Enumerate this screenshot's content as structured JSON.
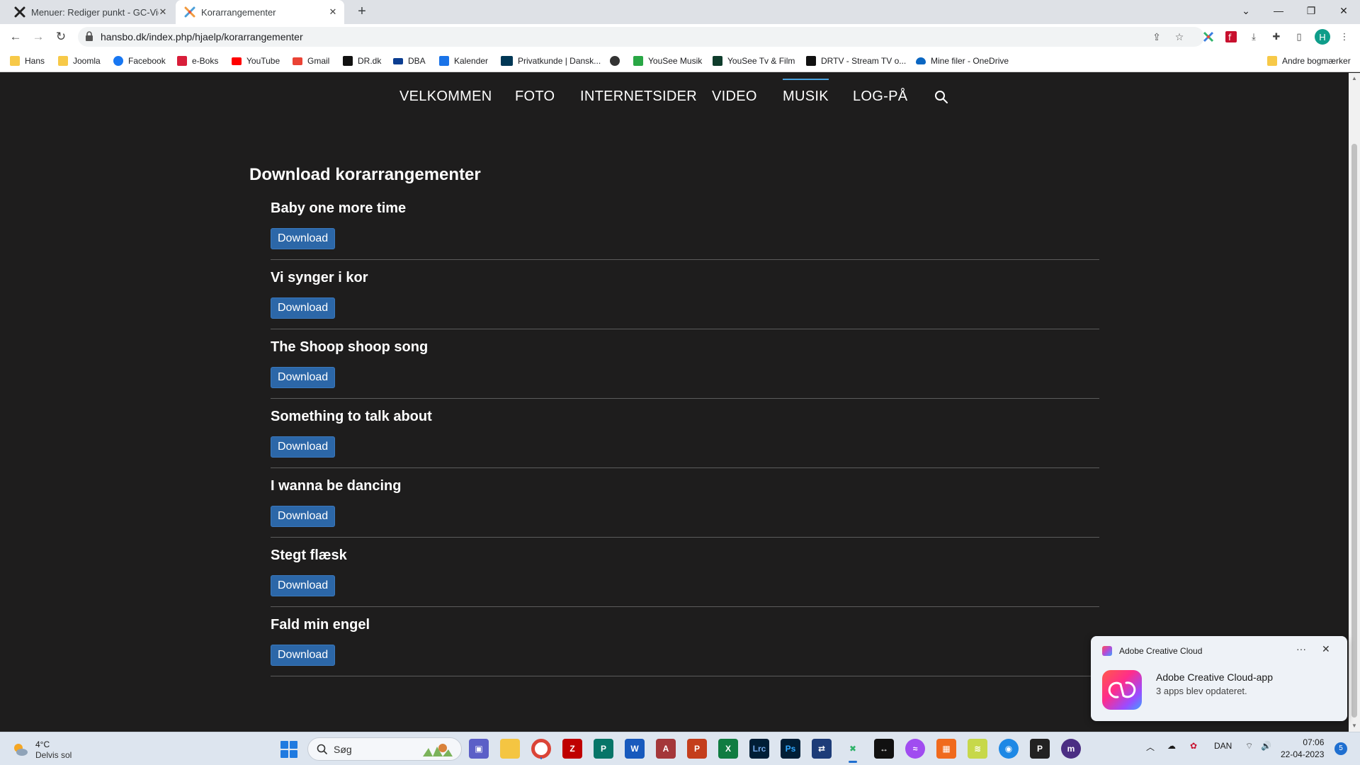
{
  "browser": {
    "tabs": [
      {
        "label": "Menuer: Rediger punkt - GC-Vid…",
        "close": "✕"
      },
      {
        "label": "Korarrangementer",
        "close": "✕"
      }
    ],
    "new_tab": "+",
    "url": "hansbo.dk/index.php/hjaelp/korarrangementer",
    "profile_initial": "H",
    "bookmarks": [
      {
        "label": "Hans",
        "icon": "folder-icon",
        "color": "#f7c948"
      },
      {
        "label": "Joomla",
        "icon": "folder-icon",
        "color": "#f7c948"
      },
      {
        "label": "Facebook",
        "icon": "facebook-icon",
        "color": "#1877f2"
      },
      {
        "label": "e-Boks",
        "icon": "eboks-icon",
        "color": "#d81e3a"
      },
      {
        "label": "YouTube",
        "icon": "youtube-icon",
        "color": "#ff0000"
      },
      {
        "label": "Gmail",
        "icon": "gmail-icon",
        "color": "#ea4335"
      },
      {
        "label": "DR.dk",
        "icon": "dr-icon",
        "color": "#111111"
      },
      {
        "label": "DBA",
        "icon": "dba-icon",
        "color": "#0b3d91"
      },
      {
        "label": "Kalender",
        "icon": "calendar-icon",
        "color": "#1a73e8"
      },
      {
        "label": "Privatkunde | Dansk...",
        "icon": "bank-icon",
        "color": "#003755"
      },
      {
        "label": "",
        "icon": "globe-icon",
        "color": "#333333"
      },
      {
        "label": "YouSee Musik",
        "icon": "music-icon",
        "color": "#29a745"
      },
      {
        "label": "YouSee Tv & Film",
        "icon": "yousee-tv-icon",
        "color": "#0f3d2c"
      },
      {
        "label": "DRTV - Stream TV o...",
        "icon": "drtv-icon",
        "color": "#111111"
      },
      {
        "label": "Mine filer - OneDrive",
        "icon": "onedrive-icon",
        "color": "#0a66c2"
      }
    ],
    "other_bookmarks": "Andre bogmærker"
  },
  "site": {
    "nav": [
      {
        "label": "VELKOMMEN",
        "active": false
      },
      {
        "label": "FOTO",
        "active": false
      },
      {
        "label": "INTERNETSIDER",
        "active": false
      },
      {
        "label": "VIDEO",
        "active": false
      },
      {
        "label": "MUSIK",
        "active": true
      },
      {
        "label": "LOG-PÅ",
        "active": false
      }
    ],
    "page_title": "Download korarrangementer",
    "download_label": "Download",
    "items": [
      {
        "title": "Baby one more time"
      },
      {
        "title": "Vi synger i kor"
      },
      {
        "title": "The Shoop shoop song"
      },
      {
        "title": "Something to talk about"
      },
      {
        "title": "I wanna be dancing"
      },
      {
        "title": "Stegt flæsk"
      },
      {
        "title": "Fald min engel"
      }
    ]
  },
  "notification": {
    "app": "Adobe Creative Cloud",
    "more": "···",
    "close": "✕",
    "title": "Adobe Creative Cloud-app",
    "body": "3 apps blev opdateret."
  },
  "taskbar": {
    "weather_temp": "4°C",
    "weather_desc": "Delvis sol",
    "search_placeholder": "Søg",
    "language": "DAN",
    "time": "07:06",
    "date": "22-04-2023",
    "badge": "5"
  },
  "colors": {
    "page_bg": "#1e1d1d",
    "button_bg": "#2c67a8",
    "active_underline": "#4aa3df"
  }
}
